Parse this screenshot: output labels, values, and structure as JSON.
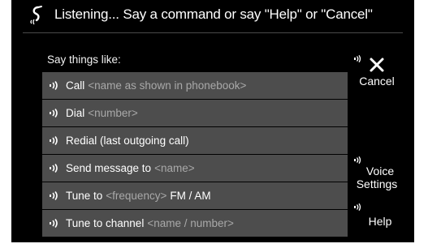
{
  "header": {
    "title": "Listening... Say a command or say \"Help\" or \"Cancel\"",
    "icon": "voice-recognition-icon"
  },
  "hint": "Say things like:",
  "commands": [
    {
      "label": "Call",
      "param": "<name as shown in phonebook>",
      "suffix": ""
    },
    {
      "label": "Dial",
      "param": "<number>",
      "suffix": ""
    },
    {
      "label": "Redial (last outgoing call)",
      "param": "",
      "suffix": ""
    },
    {
      "label": "Send message to",
      "param": "<name>",
      "suffix": ""
    },
    {
      "label": "Tune to",
      "param": "<frequency>",
      "suffix": "FM / AM"
    },
    {
      "label": "Tune to channel",
      "param": "<name / number>",
      "suffix": ""
    }
  ],
  "side": {
    "cancel_label": "Cancel",
    "voice_settings_line1": "Voice",
    "voice_settings_line2": "Settings",
    "help_label": "Help"
  },
  "colors": {
    "background": "#000000",
    "row": "#4d4d4d",
    "text": "#ffffff",
    "param_text": "#a9a9a9",
    "divider": "#4a4a4a"
  }
}
